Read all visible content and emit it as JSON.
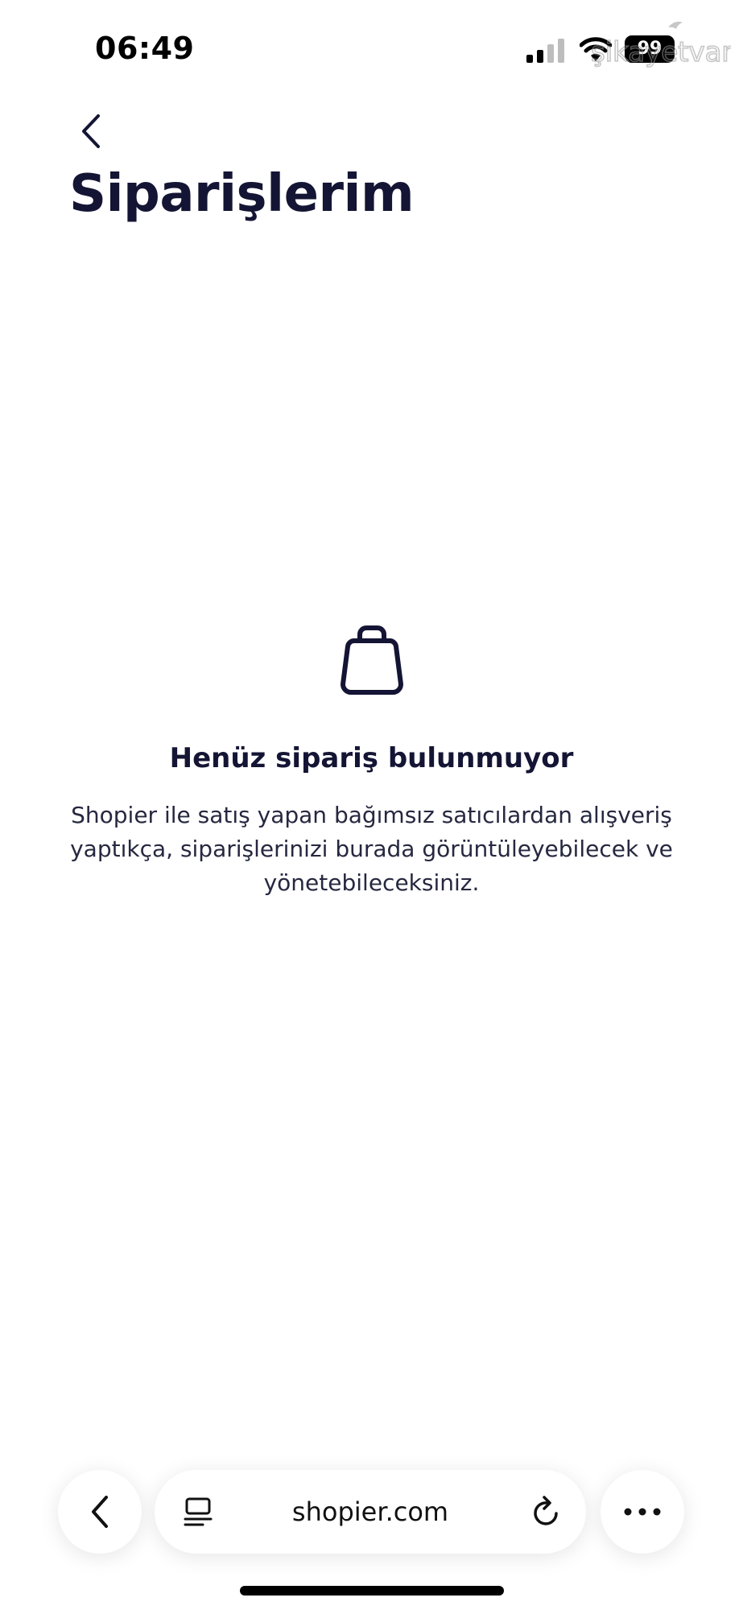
{
  "status_bar": {
    "time": "06:49",
    "battery_level": "99",
    "watermark_text": "şikayetvar"
  },
  "header": {
    "title": "Siparişlerim"
  },
  "empty_state": {
    "icon": "shopping-bag-icon",
    "title": "Henüz sipariş bulunmuyor",
    "description": "Shopier ile satış yapan bağımsız satıcılardan alışveriş yaptıkça, siparişlerinizi burada görüntüleyebilecek ve yönetebileceksiniz."
  },
  "browser": {
    "url": "shopier.com"
  },
  "colors": {
    "text_primary": "#141534",
    "background": "#ffffff"
  }
}
